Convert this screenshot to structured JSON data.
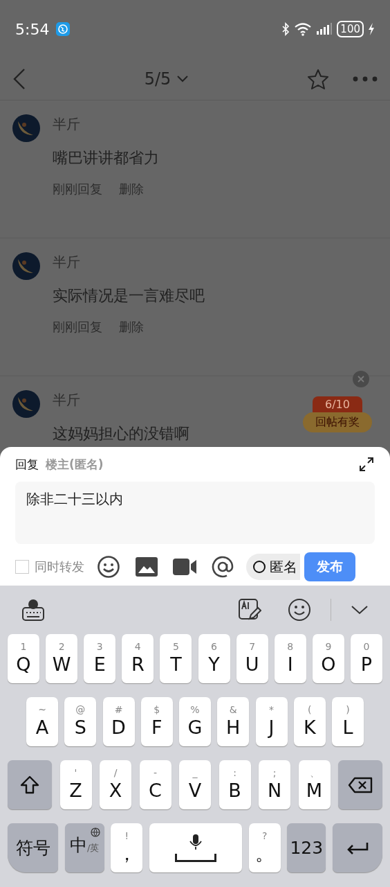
{
  "status_bar": {
    "time": "5:54",
    "battery": "100"
  },
  "nav": {
    "title": "5/5",
    "starred": false
  },
  "comments": [
    {
      "name": "半斤",
      "text": "嘴巴讲讲都省力",
      "time": "刚刚回复",
      "action": "删除"
    },
    {
      "name": "半斤",
      "text": "实际情况是一言难尽吧",
      "time": "刚刚回复",
      "action": "删除"
    },
    {
      "name": "半斤",
      "text": "这妈妈担心的没错啊"
    }
  ],
  "reward_badge": {
    "progress": "6/10",
    "label": "回帖有奖"
  },
  "reply_sheet": {
    "prefix": "回复",
    "target": "楼主(匿名)",
    "value": "除非二十三以内",
    "forward": {
      "label": "同时转发",
      "checked": false
    },
    "anonymous": {
      "label": "匿名",
      "checked": false
    },
    "submit": "发布"
  },
  "keyboard": {
    "rows": [
      {
        "keys": [
          {
            "kind": "letter",
            "label": "Q",
            "hint": "1"
          },
          {
            "kind": "letter",
            "label": "W",
            "hint": "2"
          },
          {
            "kind": "letter",
            "label": "E",
            "hint": "3"
          },
          {
            "kind": "letter",
            "label": "R",
            "hint": "4"
          },
          {
            "kind": "letter",
            "label": "T",
            "hint": "5"
          },
          {
            "kind": "letter",
            "label": "Y",
            "hint": "6"
          },
          {
            "kind": "letter",
            "label": "U",
            "hint": "7"
          },
          {
            "kind": "letter",
            "label": "I",
            "hint": "8"
          },
          {
            "kind": "letter",
            "label": "O",
            "hint": "9"
          },
          {
            "kind": "letter",
            "label": "P",
            "hint": "0"
          }
        ]
      },
      {
        "keys": [
          {
            "kind": "letter",
            "label": "A",
            "hint": "~"
          },
          {
            "kind": "letter",
            "label": "S",
            "hint": "@"
          },
          {
            "kind": "letter",
            "label": "D",
            "hint": "#"
          },
          {
            "kind": "letter",
            "label": "F",
            "hint": "$"
          },
          {
            "kind": "letter",
            "label": "G",
            "hint": "%"
          },
          {
            "kind": "letter",
            "label": "H",
            "hint": "&"
          },
          {
            "kind": "letter",
            "label": "J",
            "hint": "*"
          },
          {
            "kind": "letter",
            "label": "K",
            "hint": "("
          },
          {
            "kind": "letter",
            "label": "L",
            "hint": ")"
          }
        ]
      },
      {
        "keys": [
          {
            "kind": "shift"
          },
          {
            "kind": "letter",
            "label": "Z",
            "hint": "'"
          },
          {
            "kind": "letter",
            "label": "X",
            "hint": "/"
          },
          {
            "kind": "letter",
            "label": "C",
            "hint": "-"
          },
          {
            "kind": "letter",
            "label": "V",
            "hint": "_"
          },
          {
            "kind": "letter",
            "label": "B",
            "hint": ":"
          },
          {
            "kind": "letter",
            "label": "N",
            "hint": ";"
          },
          {
            "kind": "letter",
            "label": "M",
            "hint": "、"
          },
          {
            "kind": "backspace"
          }
        ]
      },
      {
        "keys": [
          {
            "kind": "function",
            "label": "符号"
          },
          {
            "kind": "lang",
            "label": "中",
            "sub": "/英"
          },
          {
            "kind": "letter",
            "label": "，",
            "hint": "!"
          },
          {
            "kind": "space"
          },
          {
            "kind": "letter",
            "label": "。",
            "hint": "?"
          },
          {
            "kind": "function",
            "label": "123"
          },
          {
            "kind": "enter"
          }
        ]
      }
    ]
  }
}
